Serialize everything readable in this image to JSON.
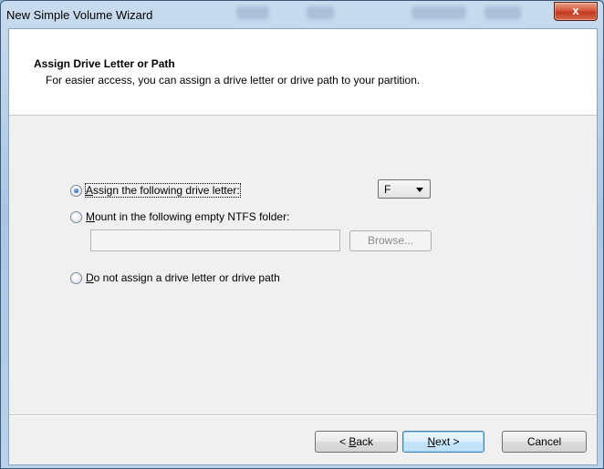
{
  "window": {
    "title": "New Simple Volume Wizard",
    "close_label": "x"
  },
  "header": {
    "title": "Assign Drive Letter or Path",
    "subtitle": "For easier access, you can assign a drive letter or drive path to your partition."
  },
  "options": [
    {
      "label_pre": "",
      "mnemonic": "A",
      "label_post": "ssign the following drive letter:",
      "checked": true
    },
    {
      "label_pre": "",
      "mnemonic": "M",
      "label_post": "ount in the following empty NTFS folder:",
      "checked": false
    },
    {
      "label_pre": "",
      "mnemonic": "D",
      "label_post": "o not assign a drive letter or drive path",
      "checked": false
    }
  ],
  "drive_letter": {
    "selected": "F"
  },
  "folder_path": {
    "value": ""
  },
  "browse": {
    "label": "Browse..."
  },
  "buttons": {
    "back_pre": "< ",
    "back_mnemonic": "B",
    "back_post": "ack",
    "next_mnemonic": "N",
    "next_post": "ext >",
    "cancel": "Cancel"
  }
}
